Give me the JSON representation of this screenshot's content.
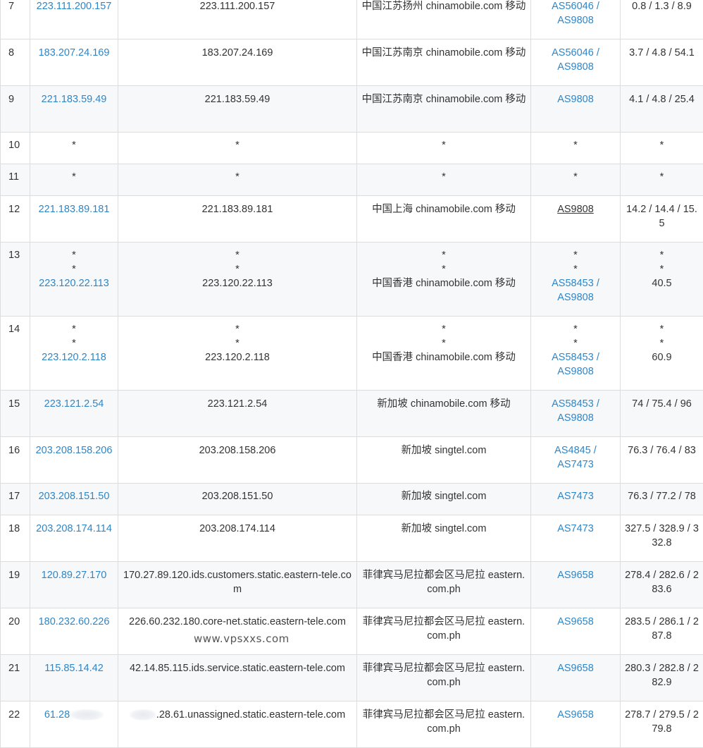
{
  "watermark": "www.vpsxxs.com",
  "rows": [
    {
      "hop": "7",
      "ip": [
        "223.111.200.157"
      ],
      "host": [
        "223.111.200.157"
      ],
      "loc": [
        "中国江苏扬州 chinamobile.com 移动"
      ],
      "as": [
        [
          "AS56046 /",
          "AS9808"
        ]
      ],
      "lat": [
        "0.8 / 1.3 / 8.9"
      ]
    },
    {
      "hop": "8",
      "ip": [
        "183.207.24.169"
      ],
      "host": [
        "183.207.24.169"
      ],
      "loc": [
        "中国江苏南京 chinamobile.com 移动"
      ],
      "as": [
        [
          "AS56046 /",
          "AS9808"
        ]
      ],
      "lat": [
        "3.7 / 4.8 / 54.1"
      ]
    },
    {
      "hop": "9",
      "ip": [
        "221.183.59.49"
      ],
      "host": [
        "221.183.59.49"
      ],
      "loc": [
        "中国江苏南京 chinamobile.com 移动"
      ],
      "as": [
        [
          "AS9808"
        ]
      ],
      "lat": [
        "4.1 / 4.8 / 25.4"
      ]
    },
    {
      "hop": "10",
      "star": "*"
    },
    {
      "hop": "11",
      "star": "*"
    },
    {
      "hop": "12",
      "ip": [
        "221.183.89.181"
      ],
      "host": [
        "221.183.89.181"
      ],
      "loc": [
        "中国上海 chinamobile.com 移动"
      ],
      "as": [
        [
          "AS9808"
        ]
      ],
      "lat": [
        "14.2 / 14.4 / 15.5"
      ]
    },
    {
      "hop": "13",
      "star": "*",
      "ip": [
        "223.120.22.113"
      ],
      "host": [
        "223.120.22.113"
      ],
      "loc": [
        "中国香港 chinamobile.com 移动"
      ],
      "as": [
        [
          "AS58453 /",
          "AS9808"
        ]
      ],
      "lat": [
        "40.5"
      ]
    },
    {
      "hop": "14",
      "star": "*",
      "ip": [
        "223.120.2.118"
      ],
      "host": [
        "223.120.2.118"
      ],
      "loc": [
        "中国香港 chinamobile.com 移动"
      ],
      "as": [
        [
          "AS58453 /",
          "AS9808"
        ]
      ],
      "lat": [
        "60.9"
      ]
    },
    {
      "hop": "15",
      "ip": [
        "223.121.2.54"
      ],
      "host": [
        "223.121.2.54"
      ],
      "loc": [
        "新加坡 chinamobile.com 移动"
      ],
      "as": [
        [
          "AS58453 /",
          "AS9808"
        ]
      ],
      "lat": [
        "74 / 75.4 / 96"
      ]
    },
    {
      "hop": "16",
      "ip": [
        "203.208.158.206"
      ],
      "host": [
        "203.208.158.206"
      ],
      "loc": [
        "新加坡 singtel.com"
      ],
      "as": [
        [
          "AS4845 /",
          "AS7473"
        ]
      ],
      "lat": [
        "76.3 / 76.4 / 83"
      ]
    },
    {
      "hop": "17",
      "ip": [
        "203.208.151.50"
      ],
      "host": [
        "203.208.151.50"
      ],
      "loc": [
        "新加坡 singtel.com"
      ],
      "as": [
        [
          "AS7473"
        ]
      ],
      "lat": [
        "76.3 / 77.2 / 78"
      ]
    },
    {
      "hop": "18",
      "ip": [
        "203.208.174.114"
      ],
      "host": [
        "203.208.174.114"
      ],
      "loc": [
        "新加坡 singtel.com"
      ],
      "as": [
        [
          "AS7473"
        ]
      ],
      "lat": [
        "327.5 / 328.9 / 332.8"
      ]
    },
    {
      "hop": "19",
      "ip": [
        "120.89.27.170"
      ],
      "host": [
        "170.27.89.120.ids.customers.static.eastern-tele.com"
      ],
      "loc": [
        "菲律宾马尼拉都会区马尼拉 eastern.com.ph"
      ],
      "as": [
        [
          "AS9658"
        ]
      ],
      "lat": [
        "278.4 / 282.6 / 283.6"
      ]
    },
    {
      "hop": "20",
      "ip": [
        "180.232.60.226"
      ],
      "host": [
        "226.60.232.180.core-net.static.eastern-tele.com"
      ],
      "loc": [
        "菲律宾马尼拉都会区马尼拉 eastern.com.ph"
      ],
      "as": [
        [
          "AS9658"
        ]
      ],
      "lat": [
        "283.5 / 286.1 / 287.8"
      ]
    },
    {
      "hop": "21",
      "ip": [
        "115.85.14.42"
      ],
      "host": [
        "42.14.85.115.ids.service.static.eastern-tele.com"
      ],
      "loc": [
        "菲律宾马尼拉都会区马尼拉 eastern.com.ph"
      ],
      "as": [
        [
          "AS9658"
        ]
      ],
      "lat": [
        "280.3 / 282.8 / 282.9"
      ]
    },
    {
      "hop": "22",
      "ip": [
        "61.28"
      ],
      "host": [
        ".28.61.unassigned.static.eastern-tele.com"
      ],
      "loc": [
        "菲律宾马尼拉都会区马尼拉 eastern.com.ph"
      ],
      "as": [
        [
          "AS9658"
        ]
      ],
      "lat": [
        "278.7 / 279.5 / 279.8"
      ]
    }
  ]
}
